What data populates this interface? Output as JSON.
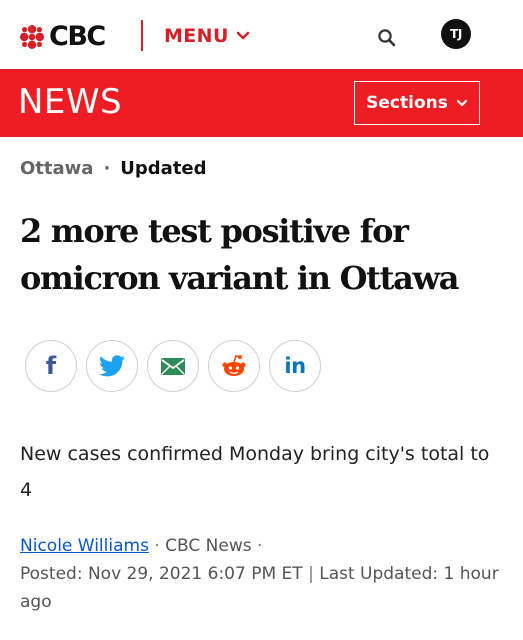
{
  "nav": {
    "logo_text": "CBC",
    "menu_label": "MENU",
    "avatar_initials": "TJ"
  },
  "newsbar": {
    "title": "NEWS",
    "sections_label": "Sections"
  },
  "article": {
    "section": "Ottawa",
    "separator": "·",
    "status": "Updated",
    "headline": "2 more test positive for omicron variant in Ottawa",
    "deck": "New cases confirmed Monday bring city's total to 4",
    "author": "Nicole Williams",
    "source": "CBC News",
    "byline_sep1": "·",
    "byline_sep2": "·",
    "posted": "Posted: Nov 29, 2021 6:07 PM ET",
    "pipe": "|",
    "last_updated": "Last Updated: 1 hour ago"
  },
  "share": [
    {
      "name": "facebook",
      "glyph": "f",
      "icon": "facebook-icon",
      "color": "#3b5998"
    },
    {
      "name": "twitter",
      "glyph": "",
      "icon": "twitter-icon",
      "color": "#1da1f2"
    },
    {
      "name": "email",
      "glyph": "",
      "icon": "email-icon",
      "color": "#2e8b57"
    },
    {
      "name": "reddit",
      "glyph": "",
      "icon": "reddit-icon",
      "color": "#ff4500"
    },
    {
      "name": "linkedin",
      "glyph": "in",
      "icon": "linkedin-icon",
      "color": "#0077b5"
    }
  ],
  "colors": {
    "brand_red": "#ee1d23",
    "menu_red": "#d81f26",
    "link_blue": "#0a58ca"
  }
}
